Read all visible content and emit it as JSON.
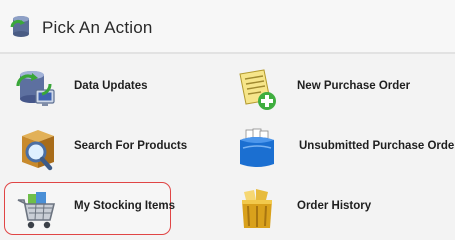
{
  "header": {
    "title": "Pick An Action",
    "icon": "database-sync-icon"
  },
  "actions": [
    {
      "label": "Data Updates",
      "icon": "data-updates-icon"
    },
    {
      "label": "New Purchase Order",
      "icon": "new-purchase-order-icon"
    },
    {
      "label": "Search For Products",
      "icon": "search-products-icon"
    },
    {
      "label": "Unsubmitted Purchase Orders",
      "icon": "unsubmitted-orders-icon"
    },
    {
      "label": "My Stocking Items",
      "icon": "shopping-cart-icon",
      "selected": true
    },
    {
      "label": "Order History",
      "icon": "order-history-icon"
    }
  ],
  "colors": {
    "highlight_border": "#e04545",
    "background": "#f3f3f3"
  }
}
